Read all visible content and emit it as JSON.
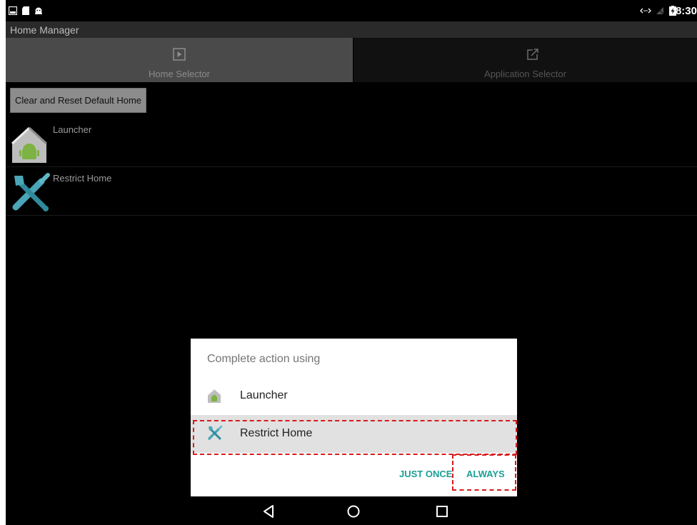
{
  "status_bar": {
    "time": "8:30",
    "left_icons": [
      "gallery-icon",
      "sd-card-icon",
      "android-debug-icon"
    ],
    "right_icons": [
      "data-sync-icon",
      "no-signal-icon",
      "battery-charging-icon"
    ]
  },
  "app": {
    "title": "Home Manager"
  },
  "tabs": [
    {
      "label": "Home Selector",
      "icon": "play-icon",
      "selected": true
    },
    {
      "label": "Application Selector",
      "icon": "edit-share-icon",
      "selected": false
    }
  ],
  "content": {
    "reset_button": "Clear and Reset Default Home",
    "apps": [
      {
        "label": "Launcher",
        "icon": "launcher-home-icon"
      },
      {
        "label": "Restrict Home",
        "icon": "tools-icon"
      }
    ]
  },
  "dialog": {
    "title": "Complete action using",
    "items": [
      {
        "label": "Launcher",
        "icon": "launcher-home-icon",
        "selected": false
      },
      {
        "label": "Restrict Home",
        "icon": "tools-icon",
        "selected": true
      }
    ],
    "buttons": {
      "just_once": "JUST ONCE",
      "always": "ALWAYS"
    },
    "accent_color": "#1a9f96"
  },
  "highlight_color": "#d81b1b",
  "nav_bar": {
    "buttons": [
      "back-icon",
      "home-circle-icon",
      "recents-icon"
    ]
  }
}
